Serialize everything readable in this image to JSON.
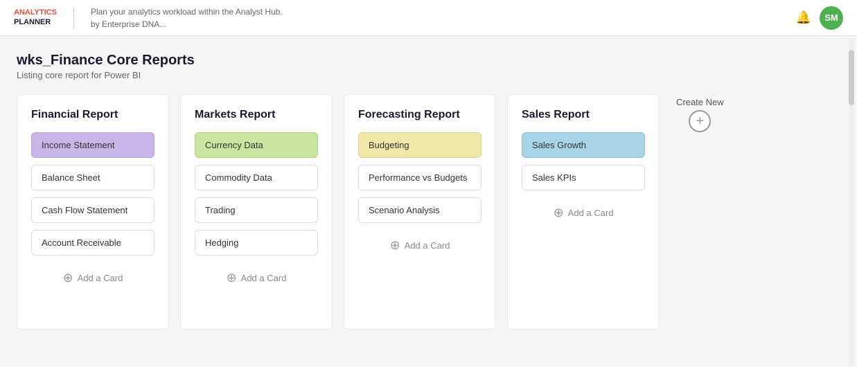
{
  "header": {
    "logo_line1": "ANALYTICS",
    "logo_line2": "PLANNER",
    "subtitle_line1": "Plan your analytics workload within the Analyst Hub.",
    "subtitle_line2": "by Enterprise DNA...",
    "avatar_initials": "SM"
  },
  "page": {
    "title": "wks_Finance Core Reports",
    "subtitle": "Listing core report for Power BI"
  },
  "create_new": {
    "label": "Create New"
  },
  "reports": [
    {
      "id": "financial",
      "title": "Financial Report",
      "items": [
        {
          "label": "Income Statement",
          "highlight": "highlight-purple"
        },
        {
          "label": "Balance Sheet",
          "highlight": ""
        },
        {
          "label": "Cash Flow Statement",
          "highlight": ""
        },
        {
          "label": "Account Receivable",
          "highlight": ""
        }
      ],
      "add_card_label": "Add a Card"
    },
    {
      "id": "markets",
      "title": "Markets Report",
      "items": [
        {
          "label": "Currency Data",
          "highlight": "highlight-green"
        },
        {
          "label": "Commodity Data",
          "highlight": ""
        },
        {
          "label": "Trading",
          "highlight": ""
        },
        {
          "label": "Hedging",
          "highlight": ""
        }
      ],
      "add_card_label": "Add a Card"
    },
    {
      "id": "forecasting",
      "title": "Forecasting Report",
      "items": [
        {
          "label": "Budgeting",
          "highlight": "highlight-yellow"
        },
        {
          "label": "Performance vs Budgets",
          "highlight": ""
        },
        {
          "label": "Scenario Analysis",
          "highlight": ""
        }
      ],
      "add_card_label": "Add a Card"
    },
    {
      "id": "sales",
      "title": "Sales Report",
      "items": [
        {
          "label": "Sales Growth",
          "highlight": "highlight-blue"
        },
        {
          "label": "Sales KPIs",
          "highlight": ""
        }
      ],
      "add_card_label": "Add a Card"
    }
  ]
}
